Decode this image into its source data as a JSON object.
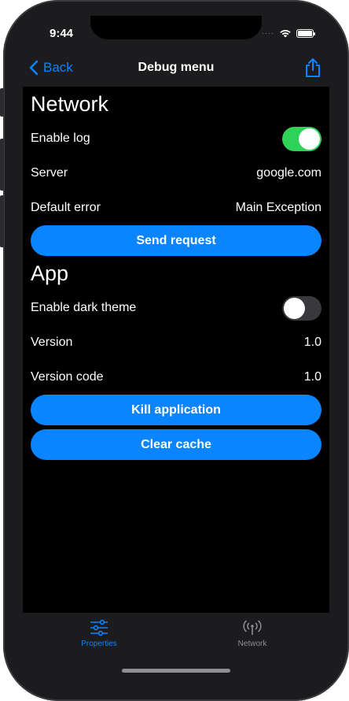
{
  "status_bar": {
    "time": "9:44",
    "cell_indicator": "····"
  },
  "nav": {
    "back_label": "Back",
    "title": "Debug menu",
    "share_icon": "share-icon"
  },
  "network": {
    "title": "Network",
    "enable_log": {
      "label": "Enable log",
      "value": true
    },
    "server": {
      "label": "Server",
      "value": "google.com"
    },
    "default_error": {
      "label": "Default error",
      "value": "Main Exception"
    },
    "send_request_label": "Send request"
  },
  "app": {
    "title": "App",
    "dark_theme": {
      "label": "Enable dark theme",
      "value": false
    },
    "version": {
      "label": "Version",
      "value": "1.0"
    },
    "version_code": {
      "label": "Version code",
      "value": "1.0"
    },
    "kill_label": "Kill application",
    "clear_cache_label": "Clear cache"
  },
  "tabs": [
    {
      "label": "Properties",
      "icon": "sliders-icon",
      "active": true
    },
    {
      "label": "Network",
      "icon": "antenna-icon",
      "active": false
    }
  ],
  "colors": {
    "accent": "#0a84ff",
    "toggle_on": "#30d158",
    "toggle_off": "#39393d",
    "bar_background": "#1c1c1e",
    "background": "#000000",
    "inactive_tab": "#8e8e93"
  }
}
